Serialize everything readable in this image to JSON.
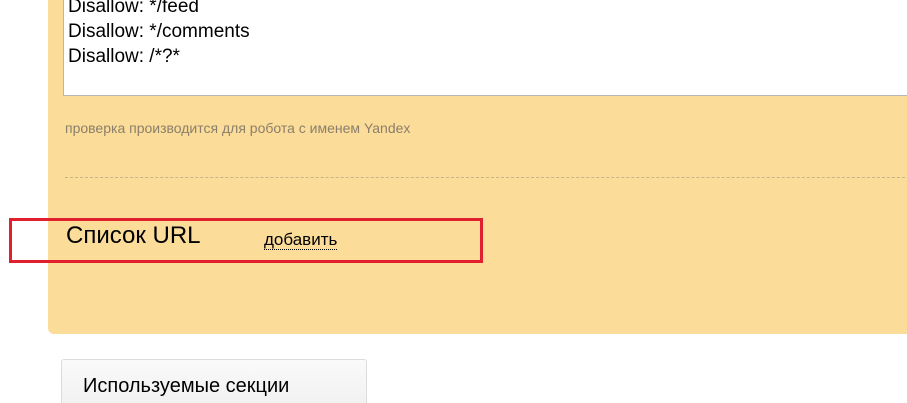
{
  "robots_txt": {
    "lines": [
      "Disallow: */feed",
      "Disallow: */comments",
      "Disallow: /*?*"
    ]
  },
  "check_hint": "проверка производится для робота с именем Yandex",
  "url_list": {
    "title": "Список URL",
    "add_label": "добавить"
  },
  "sections_tab": {
    "label": "Используемые секции"
  },
  "colors": {
    "panel_background": "#fcdc99",
    "highlight_border": "#e0202e"
  }
}
